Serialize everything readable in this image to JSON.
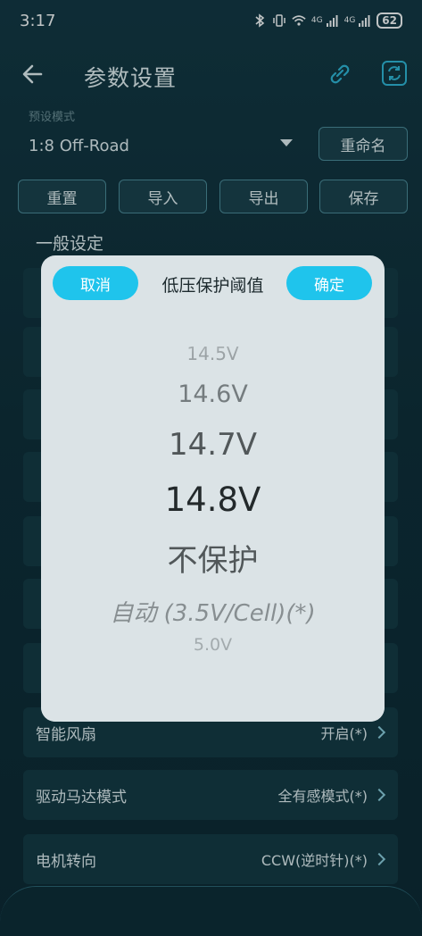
{
  "status_bar": {
    "time": "3:17",
    "network_1": "4G",
    "network_2": "4G",
    "battery": "62"
  },
  "header": {
    "title": "参数设置",
    "back_icon": "arrow-left-icon",
    "link_icon": "link-icon",
    "sync_icon": "sync-icon"
  },
  "preset": {
    "label": "预设模式",
    "value": "1:8 Off-Road",
    "rename_label": "重命名"
  },
  "toolbar": {
    "reset_label": "重置",
    "import_label": "导入",
    "export_label": "导出",
    "save_label": "保存"
  },
  "section": {
    "title": "一般设定"
  },
  "rows": [
    {
      "label": "智能风扇",
      "value": "开启(*)"
    },
    {
      "label": "驱动马达模式",
      "value": "全有感模式(*)"
    },
    {
      "label": "电机转向",
      "value": "CCW(逆时针)(*)"
    }
  ],
  "dialog": {
    "cancel_label": "取消",
    "title": "低压保护阈值",
    "confirm_label": "确定",
    "options": [
      "14.5V",
      "14.6V",
      "14.7V",
      "14.8V",
      "不保护",
      "自动 (3.5V/Cell)(*)",
      "5.0V"
    ],
    "selected": "14.8V"
  },
  "colors": {
    "accent": "#1fc4ec",
    "background": "#0f2a33",
    "dialog_bg": "#dbe3e6"
  }
}
